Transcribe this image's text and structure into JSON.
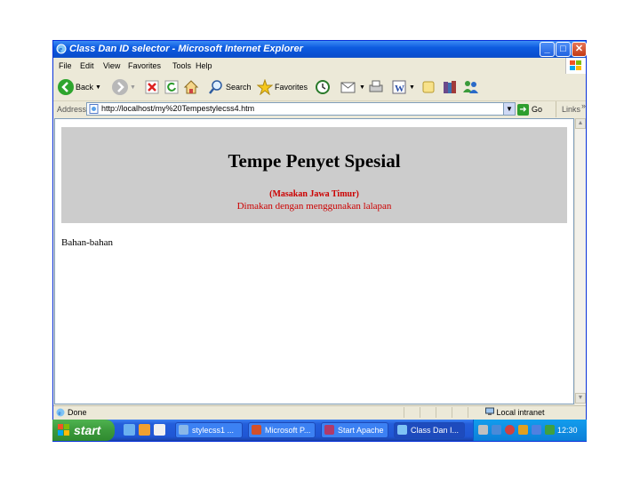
{
  "window": {
    "title": "Class Dan ID selector - Microsoft Internet Explorer",
    "minimize": "_",
    "maximize": "□",
    "close": "✕"
  },
  "menu": [
    "File",
    "Edit",
    "View",
    "Favorites",
    "Tools",
    "Help"
  ],
  "toolbar": {
    "back": "Back",
    "search": "Search",
    "favorites": "Favorites"
  },
  "address": {
    "label": "Address",
    "url": "http://localhost/my%20Tempestylecss4.htm",
    "go": "Go",
    "links": "Links",
    "links_more": "»"
  },
  "page": {
    "title": "Tempe Penyet Spesial",
    "subtitle": "(Masakan Jawa Timur)",
    "subtitle2": "Dimakan dengan menggunakan lalapan",
    "section": "Bahan-bahan"
  },
  "status": {
    "text": "Done",
    "zone": "Local intranet"
  },
  "taskbar": {
    "start": "start",
    "tasks": [
      "stylecss1 ...",
      "Microsoft P...",
      "Start Apache",
      "Class Dan I..."
    ],
    "clock": "12:30 PM"
  },
  "colors": {
    "accent": "#0a4fd0",
    "header_bg": "#cccccc",
    "subtitle": "#cc0000"
  }
}
